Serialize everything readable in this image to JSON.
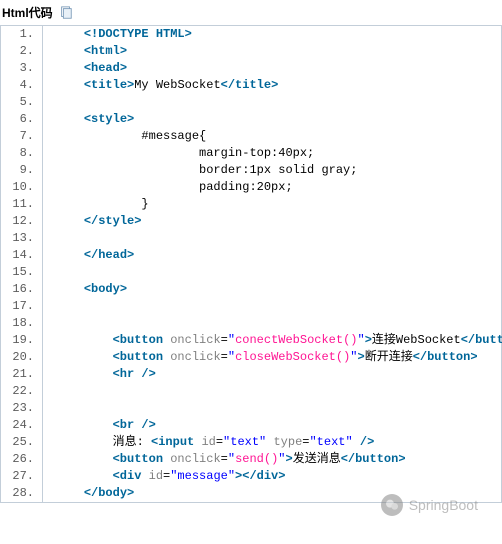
{
  "header": {
    "label": "Html代码"
  },
  "lines": [
    {
      "n": "1.",
      "spans": [
        {
          "c": "tag",
          "t": "<!DOCTYPE HTML>"
        }
      ],
      "ind": 1
    },
    {
      "n": "2.",
      "spans": [
        {
          "c": "tag",
          "t": "<html>"
        }
      ],
      "ind": 1
    },
    {
      "n": "3.",
      "spans": [
        {
          "c": "tag",
          "t": "<head>"
        }
      ],
      "ind": 1
    },
    {
      "n": "4.",
      "spans": [
        {
          "c": "tag",
          "t": "<title>"
        },
        {
          "c": "txt",
          "t": "My WebSocket"
        },
        {
          "c": "tag",
          "t": "</title>"
        }
      ],
      "ind": 1
    },
    {
      "n": "5.",
      "spans": [],
      "ind": 0
    },
    {
      "n": "6.",
      "spans": [
        {
          "c": "tag",
          "t": "<style>"
        }
      ],
      "ind": 1
    },
    {
      "n": "7.",
      "spans": [
        {
          "c": "txt",
          "t": "#message{"
        }
      ],
      "ind": 3
    },
    {
      "n": "8.",
      "spans": [
        {
          "c": "txt",
          "t": "margin-top:40px;"
        }
      ],
      "ind": 5
    },
    {
      "n": "9.",
      "spans": [
        {
          "c": "txt",
          "t": "border:1px solid gray;"
        }
      ],
      "ind": 5
    },
    {
      "n": "10.",
      "spans": [
        {
          "c": "txt",
          "t": "padding:20px;"
        }
      ],
      "ind": 5
    },
    {
      "n": "11.",
      "spans": [
        {
          "c": "txt",
          "t": "}"
        }
      ],
      "ind": 3
    },
    {
      "n": "12.",
      "spans": [
        {
          "c": "tag",
          "t": "</style>"
        }
      ],
      "ind": 1
    },
    {
      "n": "13.",
      "spans": [],
      "ind": 0
    },
    {
      "n": "14.",
      "spans": [
        {
          "c": "tag",
          "t": "</head>"
        }
      ],
      "ind": 1
    },
    {
      "n": "15.",
      "spans": [],
      "ind": 0
    },
    {
      "n": "16.",
      "spans": [
        {
          "c": "tag",
          "t": "<body>"
        }
      ],
      "ind": 1
    },
    {
      "n": "17.",
      "spans": [],
      "ind": 0
    },
    {
      "n": "18.",
      "spans": [],
      "ind": 0
    },
    {
      "n": "19.",
      "spans": [
        {
          "c": "tag",
          "t": "<button"
        },
        {
          "c": "txt",
          "t": " "
        },
        {
          "c": "attr",
          "t": "onclick"
        },
        {
          "c": "txt",
          "t": "="
        },
        {
          "c": "str",
          "t": "\""
        },
        {
          "c": "fn",
          "t": "conectWebSocket()"
        },
        {
          "c": "str",
          "t": "\""
        },
        {
          "c": "tag",
          "t": ">"
        },
        {
          "c": "txt",
          "t": "连接WebSocket"
        },
        {
          "c": "tag",
          "t": "</button>"
        }
      ],
      "ind": 2
    },
    {
      "n": "20.",
      "spans": [
        {
          "c": "tag",
          "t": "<button"
        },
        {
          "c": "txt",
          "t": " "
        },
        {
          "c": "attr",
          "t": "onclick"
        },
        {
          "c": "txt",
          "t": "="
        },
        {
          "c": "str",
          "t": "\""
        },
        {
          "c": "fn",
          "t": "closeWebSocket()"
        },
        {
          "c": "str",
          "t": "\""
        },
        {
          "c": "tag",
          "t": ">"
        },
        {
          "c": "txt",
          "t": "断开连接"
        },
        {
          "c": "tag",
          "t": "</button>"
        }
      ],
      "ind": 2
    },
    {
      "n": "21.",
      "spans": [
        {
          "c": "tag",
          "t": "<hr"
        },
        {
          "c": "txt",
          "t": " "
        },
        {
          "c": "tag",
          "t": "/>"
        }
      ],
      "ind": 2
    },
    {
      "n": "22.",
      "spans": [],
      "ind": 0
    },
    {
      "n": "23.",
      "spans": [],
      "ind": 0
    },
    {
      "n": "24.",
      "spans": [
        {
          "c": "tag",
          "t": "<br"
        },
        {
          "c": "txt",
          "t": " "
        },
        {
          "c": "tag",
          "t": "/>"
        }
      ],
      "ind": 2
    },
    {
      "n": "25.",
      "spans": [
        {
          "c": "txt",
          "t": "消息: "
        },
        {
          "c": "tag",
          "t": "<input"
        },
        {
          "c": "txt",
          "t": " "
        },
        {
          "c": "attr",
          "t": "id"
        },
        {
          "c": "txt",
          "t": "="
        },
        {
          "c": "str",
          "t": "\"text\""
        },
        {
          "c": "txt",
          "t": " "
        },
        {
          "c": "attr",
          "t": "type"
        },
        {
          "c": "txt",
          "t": "="
        },
        {
          "c": "str",
          "t": "\"text\""
        },
        {
          "c": "txt",
          "t": " "
        },
        {
          "c": "tag",
          "t": "/>"
        }
      ],
      "ind": 2
    },
    {
      "n": "26.",
      "spans": [
        {
          "c": "tag",
          "t": "<button"
        },
        {
          "c": "txt",
          "t": " "
        },
        {
          "c": "attr",
          "t": "onclick"
        },
        {
          "c": "txt",
          "t": "="
        },
        {
          "c": "str",
          "t": "\""
        },
        {
          "c": "fn",
          "t": "send()"
        },
        {
          "c": "str",
          "t": "\""
        },
        {
          "c": "tag",
          "t": ">"
        },
        {
          "c": "txt",
          "t": "发送消息"
        },
        {
          "c": "tag",
          "t": "</button>"
        }
      ],
      "ind": 2
    },
    {
      "n": "27.",
      "spans": [
        {
          "c": "tag",
          "t": "<div"
        },
        {
          "c": "txt",
          "t": " "
        },
        {
          "c": "attr",
          "t": "id"
        },
        {
          "c": "txt",
          "t": "="
        },
        {
          "c": "str",
          "t": "\"message\""
        },
        {
          "c": "tag",
          "t": ">"
        },
        {
          "c": "tag",
          "t": "</div>"
        }
      ],
      "ind": 2
    },
    {
      "n": "28.",
      "spans": [
        {
          "c": "tag",
          "t": "</body>"
        }
      ],
      "ind": 1
    }
  ],
  "watermark": "SpringBoot"
}
